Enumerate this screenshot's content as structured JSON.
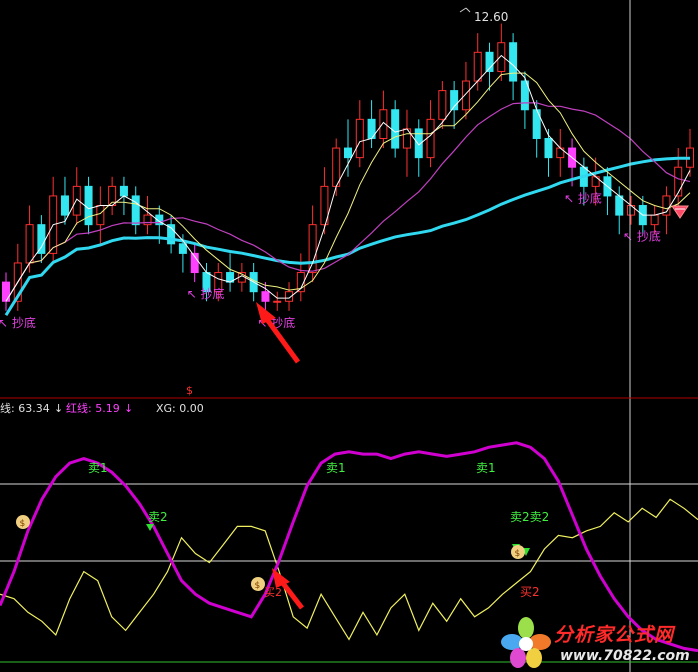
{
  "colors": {
    "background": "#000000",
    "up_candle": "#ff3030",
    "down_candle": "#33e6f0",
    "bottom_candle": "#ff40ff",
    "ma_short": "#ffffff",
    "ma_mid": "#f0f080",
    "ma_long": "#c040c0",
    "ma_slow": "#30d8f0",
    "signal_label": "#e040e0",
    "red_line": "#d000d0",
    "yellow_line": "#f0f060",
    "sell_label": "#40f040",
    "buy_label": "#ff3030",
    "separator": "#c00000",
    "arrow": "#ff1a1a"
  },
  "price_panel": {
    "high_marker": "12.60",
    "bottom_signal_label": "抄底",
    "dollar_marker": "$"
  },
  "indicator_panel": {
    "header": {
      "line1_label": "线: 63.34",
      "line1_arrow": "↓",
      "line2_label": "红线: 5.19",
      "line2_arrow": "↓",
      "xg_label": "XG: 0.00"
    },
    "sell1_label": "卖1",
    "sell2_label": "卖2",
    "sell2_double_label": "卖2卖2",
    "buy2_label": "买2",
    "buy2_small_label": "买2",
    "moneybag_icon": "$"
  },
  "watermark": {
    "title": "分析家公式网",
    "url": "www.70822.com"
  },
  "chart_data": [
    {
      "type": "candlestick",
      "title": "",
      "price_high_label": 12.6,
      "candles": [
        {
          "o": 9.9,
          "c": 9.7,
          "h": 10.0,
          "l": 9.6
        },
        {
          "o": 9.7,
          "c": 10.1,
          "h": 10.3,
          "l": 9.6
        },
        {
          "o": 10.1,
          "c": 10.5,
          "h": 10.7,
          "l": 10.0
        },
        {
          "o": 10.5,
          "c": 10.2,
          "h": 10.6,
          "l": 10.1
        },
        {
          "o": 10.2,
          "c": 10.8,
          "h": 11.0,
          "l": 10.1
        },
        {
          "o": 10.8,
          "c": 10.6,
          "h": 11.0,
          "l": 10.5
        },
        {
          "o": 10.6,
          "c": 10.9,
          "h": 11.1,
          "l": 10.5
        },
        {
          "o": 10.9,
          "c": 10.5,
          "h": 11.0,
          "l": 10.4
        },
        {
          "o": 10.5,
          "c": 10.7,
          "h": 10.9,
          "l": 10.3
        },
        {
          "o": 10.7,
          "c": 10.9,
          "h": 11.0,
          "l": 10.6
        },
        {
          "o": 10.9,
          "c": 10.8,
          "h": 11.0,
          "l": 10.6
        },
        {
          "o": 10.8,
          "c": 10.5,
          "h": 10.9,
          "l": 10.4
        },
        {
          "o": 10.5,
          "c": 10.6,
          "h": 10.8,
          "l": 10.4
        },
        {
          "o": 10.6,
          "c": 10.5,
          "h": 10.7,
          "l": 10.3
        },
        {
          "o": 10.5,
          "c": 10.3,
          "h": 10.6,
          "l": 10.2
        },
        {
          "o": 10.3,
          "c": 10.2,
          "h": 10.4,
          "l": 10.0
        },
        {
          "o": 10.2,
          "c": 10.0,
          "h": 10.3,
          "l": 9.9
        },
        {
          "o": 10.0,
          "c": 9.8,
          "h": 10.1,
          "l": 9.7
        },
        {
          "o": 9.8,
          "c": 10.0,
          "h": 10.1,
          "l": 9.7
        },
        {
          "o": 10.0,
          "c": 9.9,
          "h": 10.2,
          "l": 9.8
        },
        {
          "o": 9.9,
          "c": 10.0,
          "h": 10.1,
          "l": 9.8
        },
        {
          "o": 10.0,
          "c": 9.8,
          "h": 10.1,
          "l": 9.7
        },
        {
          "o": 9.8,
          "c": 9.7,
          "h": 9.9,
          "l": 9.6
        },
        {
          "o": 9.7,
          "c": 9.7,
          "h": 9.8,
          "l": 9.6
        },
        {
          "o": 9.7,
          "c": 9.8,
          "h": 9.9,
          "l": 9.6
        },
        {
          "o": 9.8,
          "c": 10.0,
          "h": 10.2,
          "l": 9.7
        },
        {
          "o": 10.0,
          "c": 10.5,
          "h": 10.7,
          "l": 9.9
        },
        {
          "o": 10.5,
          "c": 10.9,
          "h": 11.1,
          "l": 10.4
        },
        {
          "o": 10.9,
          "c": 11.3,
          "h": 11.4,
          "l": 10.8
        },
        {
          "o": 11.3,
          "c": 11.2,
          "h": 11.6,
          "l": 11.0
        },
        {
          "o": 11.2,
          "c": 11.6,
          "h": 11.8,
          "l": 11.1
        },
        {
          "o": 11.6,
          "c": 11.4,
          "h": 11.8,
          "l": 11.3
        },
        {
          "o": 11.4,
          "c": 11.7,
          "h": 11.9,
          "l": 11.3
        },
        {
          "o": 11.7,
          "c": 11.3,
          "h": 11.8,
          "l": 11.2
        },
        {
          "o": 11.3,
          "c": 11.5,
          "h": 11.7,
          "l": 11.0
        },
        {
          "o": 11.5,
          "c": 11.2,
          "h": 11.6,
          "l": 11.0
        },
        {
          "o": 11.2,
          "c": 11.6,
          "h": 11.8,
          "l": 11.1
        },
        {
          "o": 11.6,
          "c": 11.9,
          "h": 12.0,
          "l": 11.5
        },
        {
          "o": 11.9,
          "c": 11.7,
          "h": 12.0,
          "l": 11.5
        },
        {
          "o": 11.7,
          "c": 12.0,
          "h": 12.2,
          "l": 11.6
        },
        {
          "o": 12.0,
          "c": 12.3,
          "h": 12.5,
          "l": 11.9
        },
        {
          "o": 12.3,
          "c": 12.1,
          "h": 12.4,
          "l": 11.9
        },
        {
          "o": 12.1,
          "c": 12.4,
          "h": 12.6,
          "l": 12.0
        },
        {
          "o": 12.4,
          "c": 12.0,
          "h": 12.5,
          "l": 11.8
        },
        {
          "o": 12.0,
          "c": 11.7,
          "h": 12.1,
          "l": 11.5
        },
        {
          "o": 11.7,
          "c": 11.4,
          "h": 11.8,
          "l": 11.2
        },
        {
          "o": 11.4,
          "c": 11.2,
          "h": 11.5,
          "l": 11.0
        },
        {
          "o": 11.2,
          "c": 11.3,
          "h": 11.5,
          "l": 11.0
        },
        {
          "o": 11.3,
          "c": 11.1,
          "h": 11.4,
          "l": 10.9
        },
        {
          "o": 11.1,
          "c": 10.9,
          "h": 11.2,
          "l": 10.7
        },
        {
          "o": 10.9,
          "c": 11.0,
          "h": 11.2,
          "l": 10.7
        },
        {
          "o": 11.0,
          "c": 10.8,
          "h": 11.1,
          "l": 10.6
        },
        {
          "o": 10.8,
          "c": 10.6,
          "h": 10.9,
          "l": 10.4
        },
        {
          "o": 10.6,
          "c": 10.7,
          "h": 10.8,
          "l": 10.5
        },
        {
          "o": 10.7,
          "c": 10.5,
          "h": 10.8,
          "l": 10.4
        },
        {
          "o": 10.5,
          "c": 10.6,
          "h": 10.7,
          "l": 10.4
        },
        {
          "o": 10.6,
          "c": 10.8,
          "h": 10.9,
          "l": 10.4
        },
        {
          "o": 10.8,
          "c": 11.1,
          "h": 11.3,
          "l": 10.7
        },
        {
          "o": 11.1,
          "c": 11.3,
          "h": 11.5,
          "l": 11.0
        }
      ],
      "bottom_signals": [
        0,
        16,
        22,
        48,
        53
      ]
    },
    {
      "type": "line",
      "title": "",
      "ylim": [
        0,
        100
      ],
      "series": [
        {
          "name": "红线",
          "values": [
            25,
            40,
            58,
            72,
            82,
            88,
            90,
            88,
            84,
            78,
            70,
            60,
            48,
            36,
            30,
            26,
            24,
            22,
            20,
            30,
            45,
            62,
            78,
            88,
            92,
            93,
            92,
            92,
            90,
            92,
            93,
            92,
            91,
            92,
            93,
            95,
            96,
            97,
            95,
            90,
            80,
            65,
            50,
            38,
            28,
            20,
            14,
            10,
            8,
            6,
            5
          ]
        },
        {
          "name": "线",
          "values": [
            30,
            28,
            22,
            18,
            12,
            28,
            40,
            36,
            20,
            14,
            22,
            30,
            40,
            55,
            48,
            44,
            52,
            60,
            60,
            58,
            40,
            20,
            15,
            30,
            20,
            10,
            22,
            12,
            24,
            30,
            14,
            26,
            18,
            28,
            20,
            24,
            30,
            35,
            40,
            50,
            56,
            55,
            58,
            60,
            66,
            62,
            68,
            64,
            72,
            68,
            63
          ]
        }
      ],
      "annotations": [
        "卖1",
        "卖2",
        "卖2卖2",
        "买2"
      ]
    }
  ]
}
